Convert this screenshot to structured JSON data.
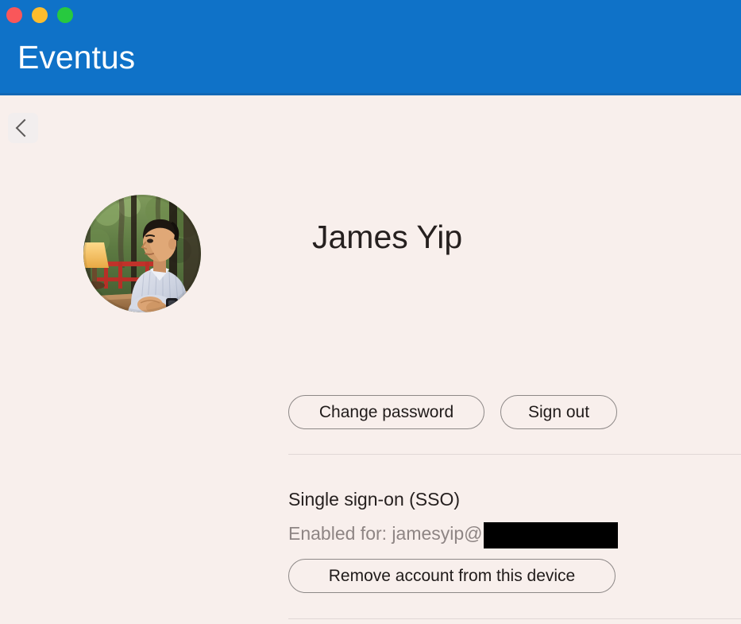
{
  "window": {
    "traffic_lights": [
      {
        "name": "close",
        "color": "#f9575a"
      },
      {
        "name": "minimize",
        "color": "#fdbd2e"
      },
      {
        "name": "maximize",
        "color": "#27c93f"
      }
    ],
    "header_color": "#0f72c8",
    "background_color": "#f8efec"
  },
  "header": {
    "app_title": "Eventus"
  },
  "nav": {
    "back_icon": "chevron-left-icon"
  },
  "profile": {
    "avatar_alt": "Profile photo of James Yip",
    "name": "James Yip"
  },
  "actions": {
    "change_password_label": "Change password",
    "sign_out_label": "Sign out"
  },
  "sso": {
    "title": "Single sign-on (SSO)",
    "enabled_for_prefix": "Enabled for: jamesyip@",
    "domain_redacted": true,
    "remove_account_label": "Remove account from this device"
  }
}
